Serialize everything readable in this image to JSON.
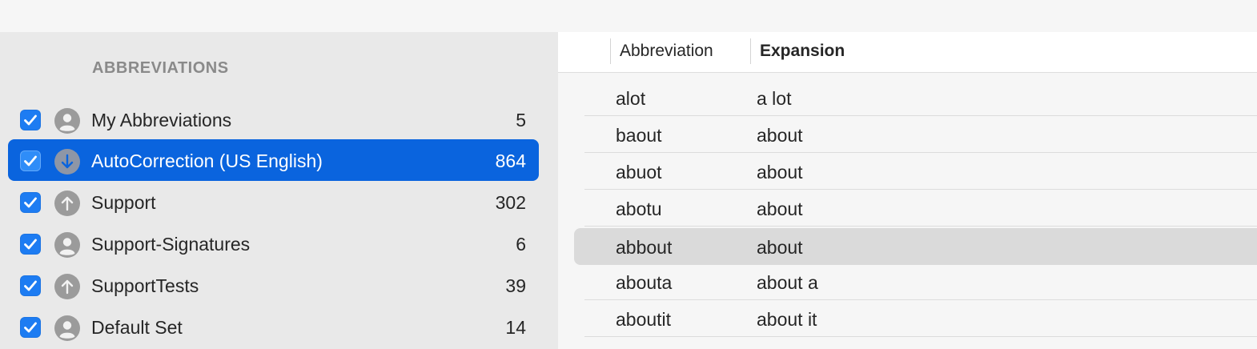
{
  "sidebar": {
    "section_title": "ABBREVIATIONS",
    "items": [
      {
        "label": "My Abbreviations",
        "count": "5",
        "checked": true,
        "icon": "person-icon",
        "selected": false
      },
      {
        "label": "AutoCorrection (US English)",
        "count": "864",
        "checked": true,
        "icon": "download-arrow-icon",
        "selected": true
      },
      {
        "label": "Support",
        "count": "302",
        "checked": true,
        "icon": "upload-arrow-icon",
        "selected": false
      },
      {
        "label": "Support-Signatures",
        "count": "6",
        "checked": true,
        "icon": "person-icon",
        "selected": false
      },
      {
        "label": "SupportTests",
        "count": "39",
        "checked": true,
        "icon": "upload-arrow-icon",
        "selected": false
      },
      {
        "label": "Default Set",
        "count": "14",
        "checked": true,
        "icon": "person-icon",
        "selected": false
      }
    ]
  },
  "table": {
    "columns": [
      "Abbreviation",
      "Expansion"
    ],
    "sorted_column": "Expansion",
    "rows": [
      {
        "abbreviation": "alot",
        "expansion": "a lot"
      },
      {
        "abbreviation": "baout",
        "expansion": "about"
      },
      {
        "abbreviation": "abuot",
        "expansion": "about"
      },
      {
        "abbreviation": "abotu",
        "expansion": "about"
      },
      {
        "abbreviation": "abbout",
        "expansion": "about",
        "highlighted": true
      },
      {
        "abbreviation": "abouta",
        "expansion": "about a"
      },
      {
        "abbreviation": "aboutit",
        "expansion": "about it"
      }
    ]
  },
  "colors": {
    "selection": "#0a64de",
    "checkbox": "#1d7cf2",
    "sidebar_bg": "#e9e9e9",
    "row_highlight": "#dadada"
  }
}
